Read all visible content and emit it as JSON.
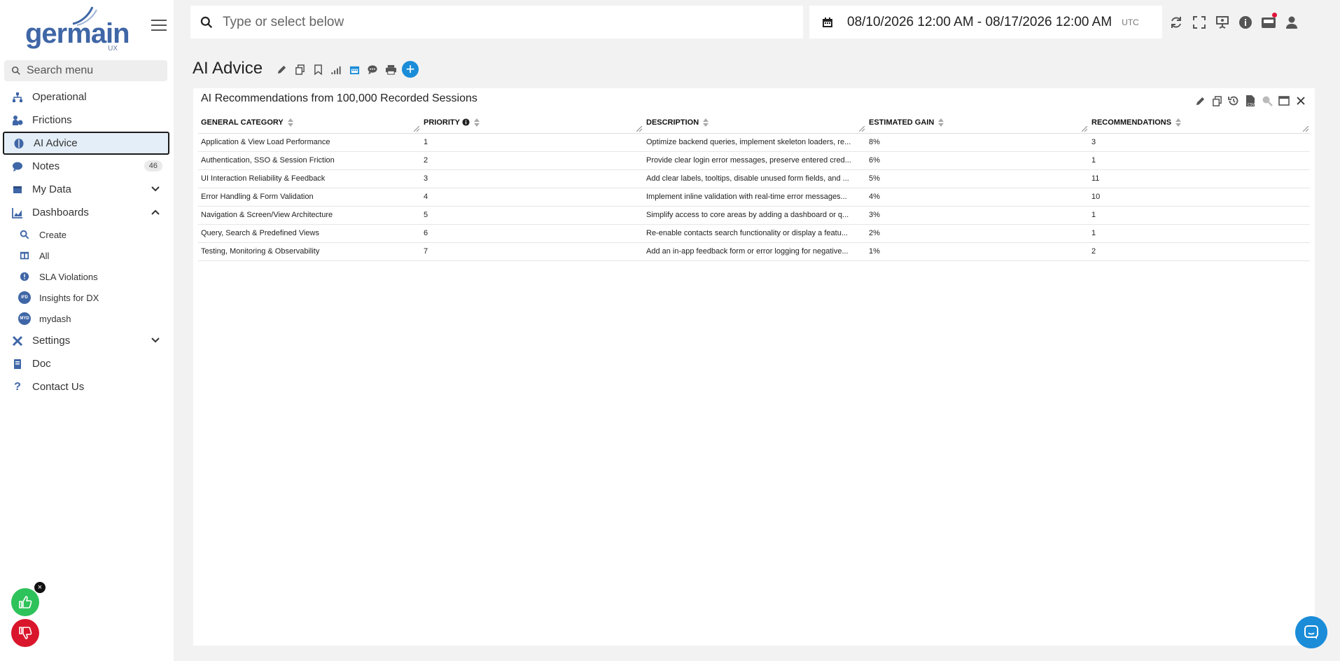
{
  "brand": {
    "word": "germain",
    "sub": "UX"
  },
  "sidebar": {
    "search_placeholder": "Search menu",
    "items": [
      {
        "label": "Operational"
      },
      {
        "label": "Frictions"
      },
      {
        "label": "AI Advice"
      },
      {
        "label": "Notes",
        "badge": "46"
      },
      {
        "label": "My Data"
      },
      {
        "label": "Dashboards"
      }
    ],
    "dashboards": [
      {
        "label": "Create"
      },
      {
        "label": "All"
      },
      {
        "label": "SLA Violations"
      },
      {
        "label": "Insights for DX",
        "initials": "IFD"
      },
      {
        "label": "mydash",
        "initials": "MYD"
      }
    ],
    "bottom_items": [
      {
        "label": "Settings"
      },
      {
        "label": "Doc"
      },
      {
        "label": "Contact Us"
      }
    ]
  },
  "topbar": {
    "search_placeholder": "Type or select below",
    "date_range": "08/10/2026 12:00 AM - 08/17/2026 12:00 AM",
    "timezone": "UTC"
  },
  "page": {
    "title": "AI Advice"
  },
  "panel": {
    "title": "AI Recommendations from 100,000 Recorded Sessions",
    "columns": [
      "GENERAL CATEGORY",
      "PRIORITY",
      "DESCRIPTION",
      "ESTIMATED GAIN",
      "RECOMMENDATIONS"
    ],
    "rows": [
      [
        "Application & View Load Performance",
        "1",
        "Optimize backend queries, implement skeleton loaders, re...",
        "8%",
        "3"
      ],
      [
        "Authentication, SSO & Session Friction",
        "2",
        "Provide clear login error messages, preserve entered cred...",
        "6%",
        "1"
      ],
      [
        "UI Interaction Reliability & Feedback",
        "3",
        "Add clear labels, tooltips, disable unused form fields, and ...",
        "5%",
        "11"
      ],
      [
        "Error Handling & Form Validation",
        "4",
        "Implement inline validation with real-time error messages...",
        "4%",
        "10"
      ],
      [
        "Navigation & Screen/View Architecture",
        "5",
        "Simplify access to core areas by adding a dashboard or q...",
        "3%",
        "1"
      ],
      [
        "Query, Search & Predefined Views",
        "6",
        "Re-enable contacts search functionality or display a featu...",
        "2%",
        "1"
      ],
      [
        "Testing, Monitoring & Observability",
        "7",
        "Add an in-app feedback form or error logging for negative...",
        "1%",
        "2"
      ]
    ]
  },
  "colors": {
    "accent": "#3f66a6",
    "blue": "#1a8cd8",
    "green": "#2ec25a",
    "red": "#d9162b"
  }
}
